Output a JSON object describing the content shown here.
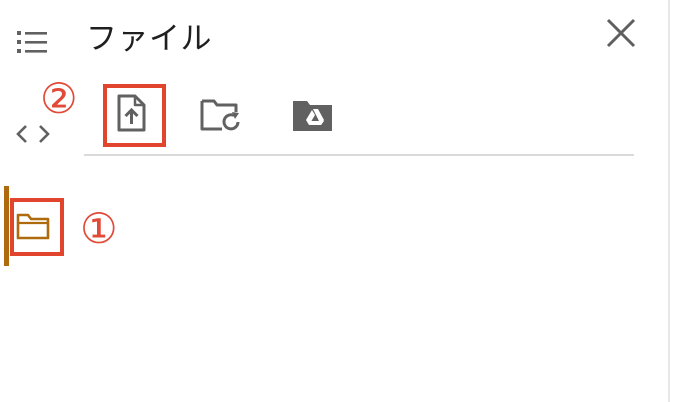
{
  "panel": {
    "title": "ファイル"
  },
  "sidebar": {
    "icons": [
      "list-icon",
      "code-icon",
      "folder-icon"
    ]
  },
  "toolbar": {
    "buttons": [
      "upload-file-icon",
      "refresh-folder-icon",
      "drive-folder-icon"
    ]
  },
  "annotations": {
    "one": "①",
    "two": "②"
  },
  "colors": {
    "icon_gray": "#616161",
    "folder_orange": "#b06a0e",
    "annotation_red": "#e2452d"
  }
}
